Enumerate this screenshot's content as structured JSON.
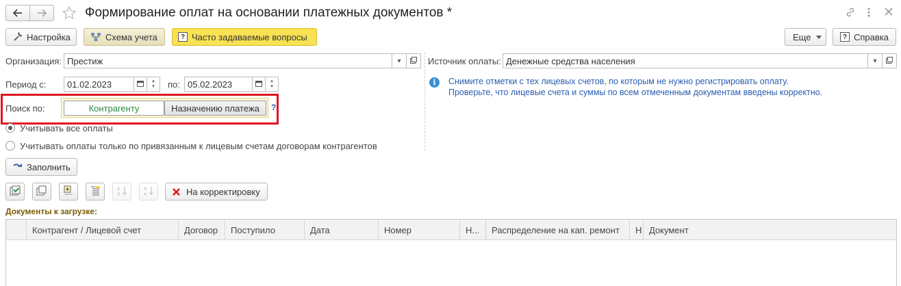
{
  "window": {
    "title": "Формирование оплат на основании платежных документов *"
  },
  "toolbar": {
    "settings_label": "Настройка",
    "scheme_label": "Схема учета",
    "faq_label": "Часто задаваемые вопросы",
    "more_label": "Еще",
    "help_label": "Справка"
  },
  "form": {
    "org_label": "Организация:",
    "org_value": "Престиж",
    "period_label": "Период с:",
    "period_from": "01.02.2023",
    "period_to_label": "по:",
    "period_to": "05.02.2023",
    "search_label": "Поиск по:",
    "search_options": [
      "Контрагенту",
      "Назначению платежа"
    ],
    "search_help": "?",
    "radio_all": "Учитывать все оплаты",
    "radio_linked": "Учитывать оплаты только по привязанным к лицевым счетам договорам контрагентов",
    "source_label": "Источник оплаты:",
    "source_value": "Денежные средства населения",
    "info_line1": "Снимите отметки с тех лицевых счетов, по которым не нужно регистрировать оплату.",
    "info_line2": "Проверьте, что лицевые счета и суммы по всем отмеченным документам введены корректно.",
    "fill_label": "Заполнить",
    "correction_label": "На корректировку"
  },
  "table": {
    "section_label": "Документы к загрузке:",
    "columns": [
      "Контрагент / Лицевой счет",
      "Договор",
      "Поступило",
      "Дата",
      "Номер",
      "Н...",
      "Распределение на кап. ремонт",
      "Н",
      "Документ"
    ]
  },
  "colors": {
    "accent_yellow": "#f9e154",
    "highlight_red": "#e0141e",
    "search_active_text": "#2a8a3e",
    "info_text": "#2a5db0",
    "section_label": "#7a5a00"
  }
}
